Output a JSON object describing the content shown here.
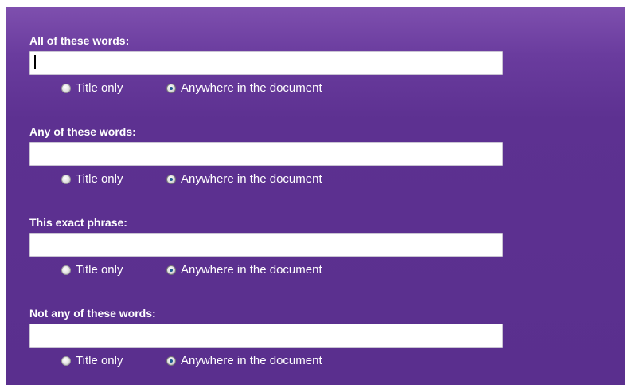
{
  "search_groups": [
    {
      "label": "All of these words:",
      "value": "",
      "options": {
        "title_only": "Title only",
        "anywhere": "Anywhere in the document"
      },
      "selected": "anywhere"
    },
    {
      "label": "Any of these words:",
      "value": "",
      "options": {
        "title_only": "Title only",
        "anywhere": "Anywhere in the document"
      },
      "selected": "anywhere"
    },
    {
      "label": "This exact phrase:",
      "value": "",
      "options": {
        "title_only": "Title only",
        "anywhere": "Anywhere in the document"
      },
      "selected": "anywhere"
    },
    {
      "label": "Not any of these words:",
      "value": "",
      "options": {
        "title_only": "Title only",
        "anywhere": "Anywhere in the document"
      },
      "selected": "anywhere"
    }
  ],
  "colors": {
    "panel_background": "#5d3191",
    "label_text": "#ffffff",
    "field_background": "#ffffff",
    "radio_selected_dot": "#1f5a92"
  }
}
